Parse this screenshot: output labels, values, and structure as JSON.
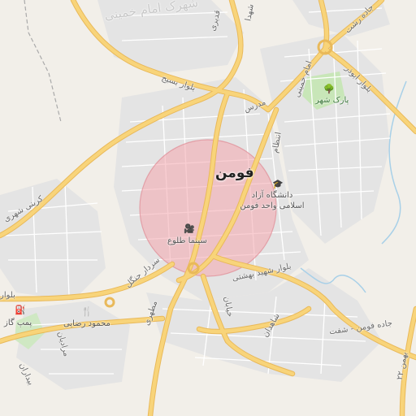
{
  "map": {
    "city_name": "فومن",
    "highlight_color": "#f4a6ad",
    "road_color": "#f8d47a",
    "residential_color": "#e4e4e4",
    "park_color": "#c8e6b8",
    "water_color": "#a8d0e8",
    "labels": {
      "top_faded": "شهرک امام خمینی",
      "road_north_vertical": "شهدا",
      "road_north_small": "قدیری",
      "road_imam": "امام خمینی",
      "road_rasht": "جاده رشت",
      "blvd_abuzar": "بلوار ابوذر",
      "blvd_basij": "بلوار بسیج",
      "road_modarres": "مدرس",
      "road_entezam": "انتظام",
      "blvd_shafti": "بلوار شهید بهشتی",
      "road_fuman_shaft": "جاده فومن - شفت",
      "road_karbasi": "کربنی شهری",
      "road_sardar_jangal": "سردار جنگل",
      "road_motahari": "مطهری",
      "road_khayyam": "خیابان",
      "road_shahedan": "شاهدان",
      "road_bahman": "بهمن ۲۲",
      "road_mardani": "مرادیان",
      "road_bidarkhani": "بیداران",
      "blvd_west": "بلوار",
      "university": "دانشگاه آزاد اسلامی واحد فومن",
      "cinema": "سینما طلوع",
      "park": "پارک شهر",
      "gas_station": "پمپ گاز",
      "restaurant": "محمود رضایی"
    },
    "icons": {
      "university": "graduation-cap-icon",
      "cinema": "camera-icon",
      "park": "tree-icon",
      "gas_station": "fuel-pump-icon",
      "restaurant": "fork-knife-icon"
    }
  }
}
